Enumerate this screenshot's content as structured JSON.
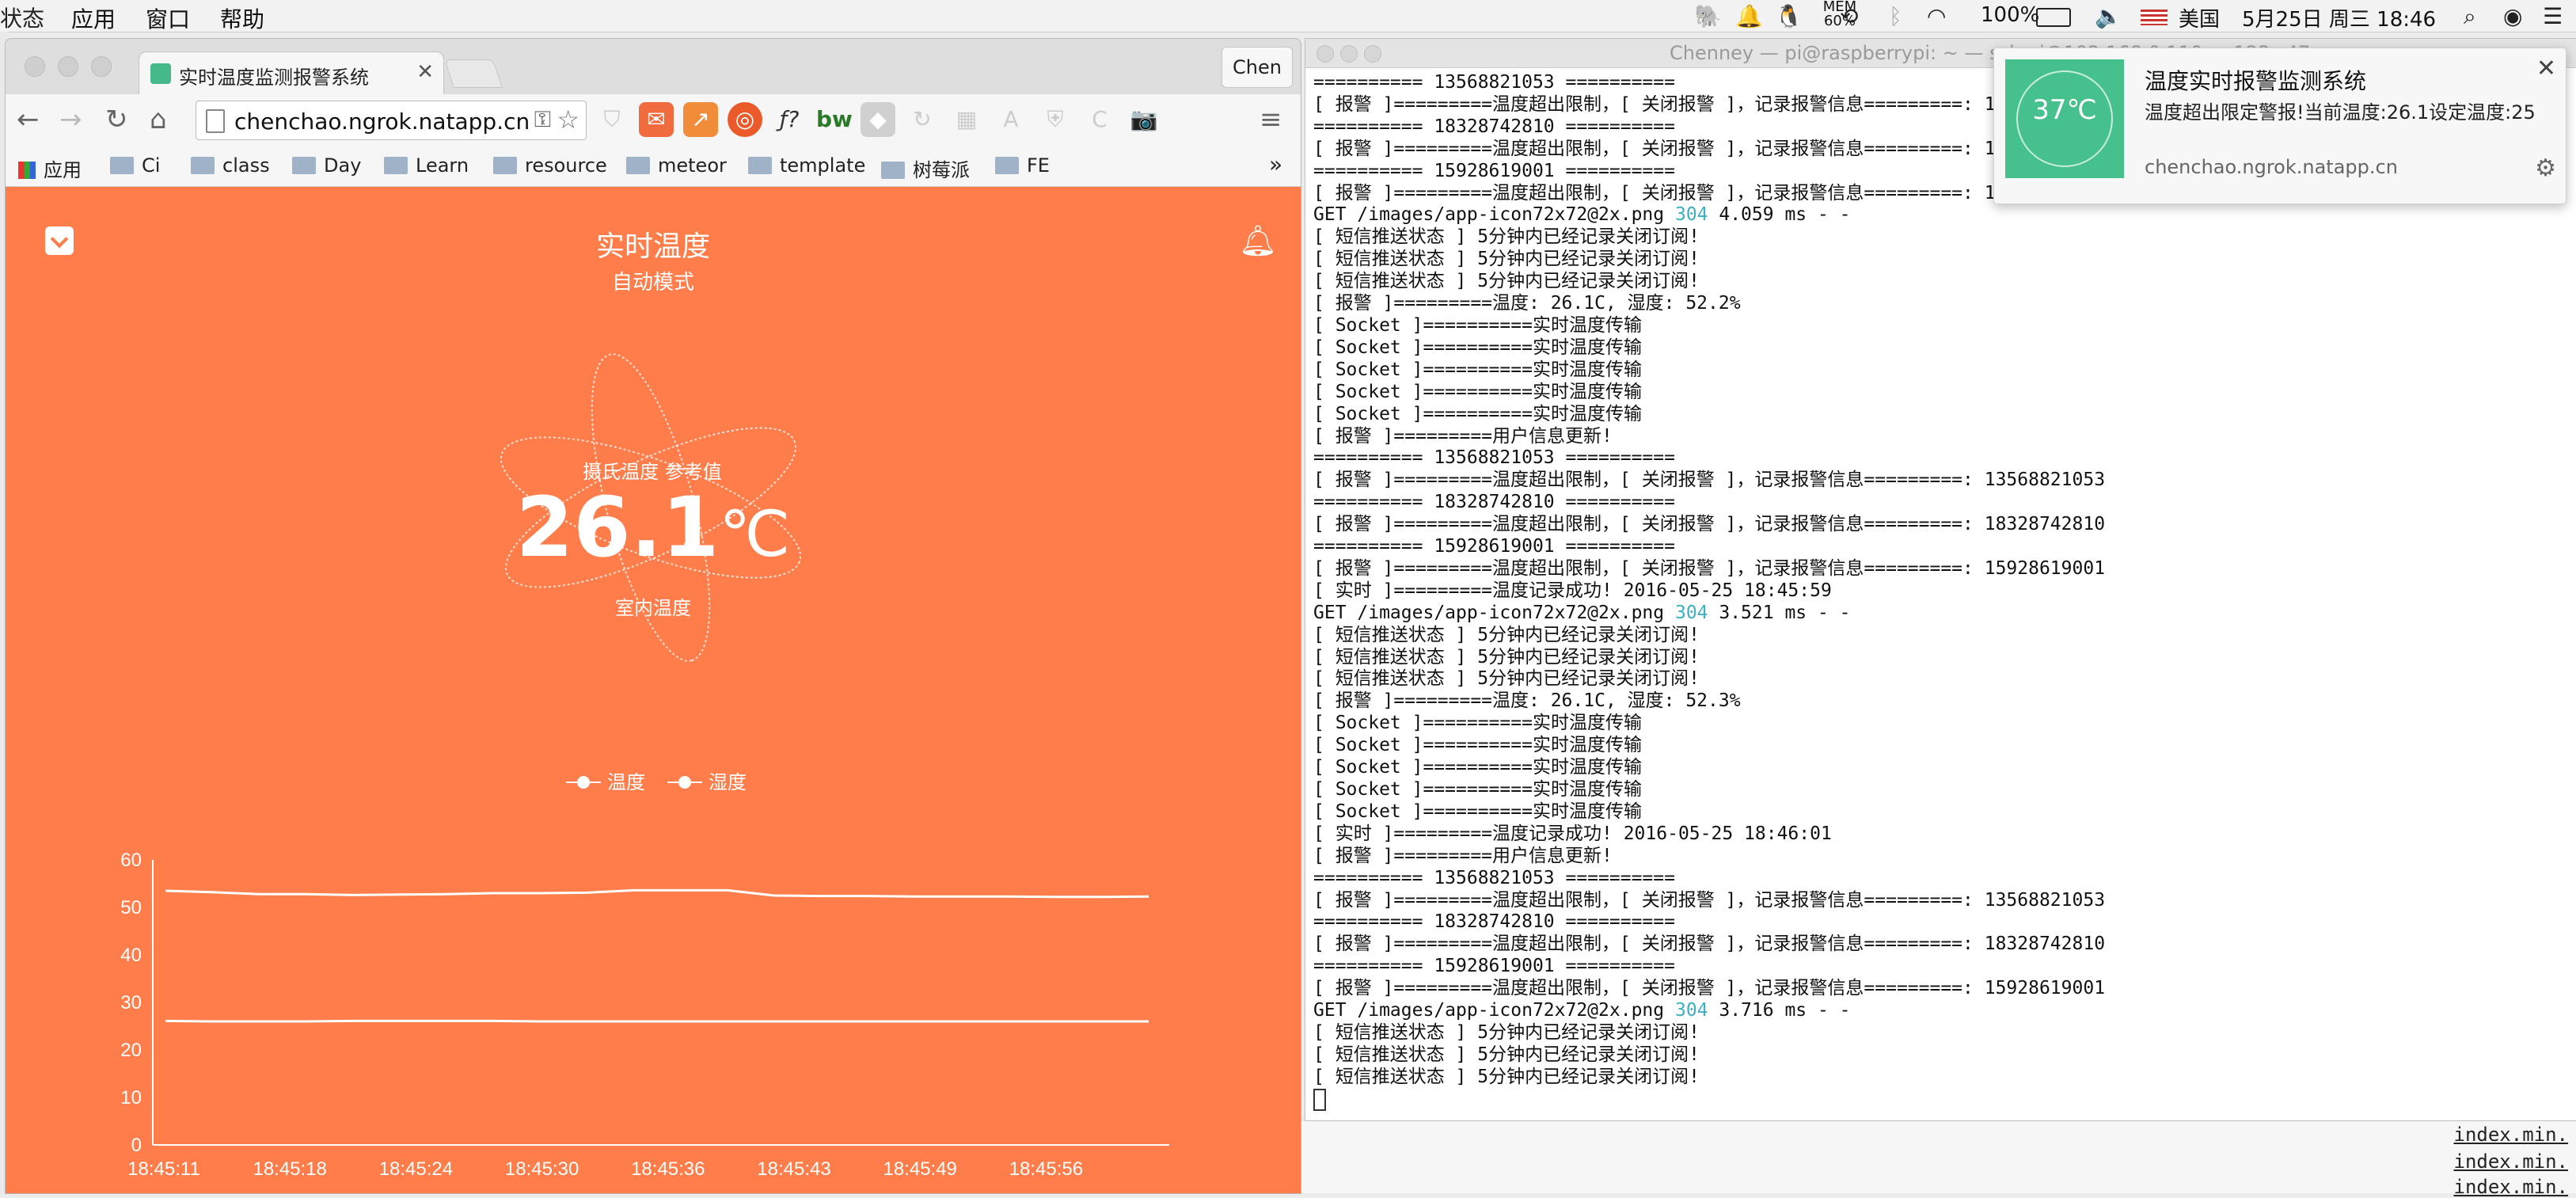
{
  "menubar": {
    "items": [
      "状态",
      "应用",
      "窗口",
      "帮助"
    ],
    "mem": "MEM",
    "mem_pct": "60%",
    "battery": "100%",
    "input_source": "美国",
    "datetime": "5月25日 周三  18:46"
  },
  "browser": {
    "tab_title": "实时温度监测报警系统",
    "profile": "Chen",
    "url": "chenchao.ngrok.natapp.cn",
    "bookmarks": [
      "应用",
      "Ci",
      "class",
      "Day",
      "Learn",
      "resource",
      "meteor",
      "template",
      "树莓派",
      "FE"
    ]
  },
  "app": {
    "title": "实时温度",
    "mode": "自动模式",
    "label_top": "摄氏温度 参考值",
    "temperature": "26.1",
    "unit": "℃",
    "label_bottom": "室内温度",
    "legend": [
      "温度",
      "湿度"
    ]
  },
  "chart_data": {
    "type": "line",
    "x": [
      "18:45:11",
      "18:45:18",
      "18:45:24",
      "18:45:30",
      "18:45:36",
      "18:45:43",
      "18:45:49",
      "18:45:56"
    ],
    "ylim": [
      0,
      60
    ],
    "yticks": [
      0,
      10,
      20,
      30,
      40,
      50,
      60
    ],
    "series": [
      {
        "name": "温度",
        "values": [
          26.1,
          26.0,
          26.0,
          26.0,
          26.1,
          26.1,
          26.1,
          26.1,
          26.0,
          26.0,
          26.0,
          26.0,
          26.0,
          26.0,
          26.0,
          26.0,
          26.0,
          26.0,
          26.0,
          26.0,
          26.0,
          26.0
        ]
      },
      {
        "name": "湿度",
        "values": [
          53.5,
          53.2,
          52.8,
          52.8,
          52.6,
          52.7,
          52.8,
          53.0,
          53.0,
          53.1,
          53.6,
          53.6,
          53.6,
          52.5,
          52.4,
          52.4,
          52.3,
          52.3,
          52.3,
          52.2,
          52.2,
          52.3
        ]
      }
    ],
    "grid": false
  },
  "terminal": {
    "title": "Chenney — pi@raspberrypi: ~ — ssh pi@192.168.0.110 — 123×47",
    "lines": [
      "========== 13568821053 ==========",
      "[ 报警 ]=========温度超出限制，[ 关闭报警 ]，记录报警信息=========: 13568821053",
      "========== 18328742810 ==========",
      "[ 报警 ]=========温度超出限制，[ 关闭报警 ]，记录报警信息=========: 18328742810",
      "========== 15928619001 ==========",
      "[ 报警 ]=========温度超出限制，[ 关闭报警 ]，记录报警信息=========: 15928619001",
      "GET /images/app-icon72x72@2x.png |304| 4.059 ms - -",
      "[ 短信推送状态 ] 5分钟内已经记录关闭订阅!",
      "[ 短信推送状态 ] 5分钟内已经记录关闭订阅!",
      "[ 短信推送状态 ] 5分钟内已经记录关闭订阅!",
      "[ 报警 ]=========温度: 26.1C, 湿度: 52.2%",
      "[ Socket ]==========实时温度传输",
      "[ Socket ]==========实时温度传输",
      "[ Socket ]==========实时温度传输",
      "[ Socket ]==========实时温度传输",
      "[ Socket ]==========实时温度传输",
      "[ 报警 ]=========用户信息更新!",
      "========== 13568821053 ==========",
      "[ 报警 ]=========温度超出限制，[ 关闭报警 ]，记录报警信息=========: 13568821053",
      "========== 18328742810 ==========",
      "[ 报警 ]=========温度超出限制，[ 关闭报警 ]，记录报警信息=========: 18328742810",
      "========== 15928619001 ==========",
      "[ 报警 ]=========温度超出限制，[ 关闭报警 ]，记录报警信息=========: 15928619001",
      "[ 实时 ]=========温度记录成功! 2016-05-25 18:45:59",
      "GET /images/app-icon72x72@2x.png |304| 3.521 ms - -",
      "[ 短信推送状态 ] 5分钟内已经记录关闭订阅!",
      "[ 短信推送状态 ] 5分钟内已经记录关闭订阅!",
      "[ 短信推送状态 ] 5分钟内已经记录关闭订阅!",
      "[ 报警 ]=========温度: 26.1C, 湿度: 52.3%",
      "[ Socket ]==========实时温度传输",
      "[ Socket ]==========实时温度传输",
      "[ Socket ]==========实时温度传输",
      "[ Socket ]==========实时温度传输",
      "[ Socket ]==========实时温度传输",
      "[ 实时 ]=========温度记录成功! 2016-05-25 18:46:01",
      "[ 报警 ]=========用户信息更新!",
      "========== 13568821053 ==========",
      "[ 报警 ]=========温度超出限制，[ 关闭报警 ]，记录报警信息=========: 13568821053",
      "========== 18328742810 ==========",
      "[ 报警 ]=========温度超出限制，[ 关闭报警 ]，记录报警信息=========: 18328742810",
      "========== 15928619001 ==========",
      "[ 报警 ]=========温度超出限制，[ 关闭报警 ]，记录报警信息=========: 15928619001",
      "GET /images/app-icon72x72@2x.png |304| 3.716 ms - -",
      "[ 短信推送状态 ] 5分钟内已经记录关闭订阅!",
      "[ 短信推送状态 ] 5分钟内已经记录关闭订阅!",
      "[ 短信推送状态 ] 5分钟内已经记录关闭订阅!"
    ]
  },
  "notification": {
    "title": "温度实时报警监测系统",
    "body": "温度超出限定警报!当前温度:26.1设定温度:25",
    "source": "chenchao.ngrok.natapp.cn",
    "icon_temp": "37℃"
  },
  "background_window": {
    "lines": [
      "index.min.",
      "index.min.",
      "index.min."
    ]
  }
}
